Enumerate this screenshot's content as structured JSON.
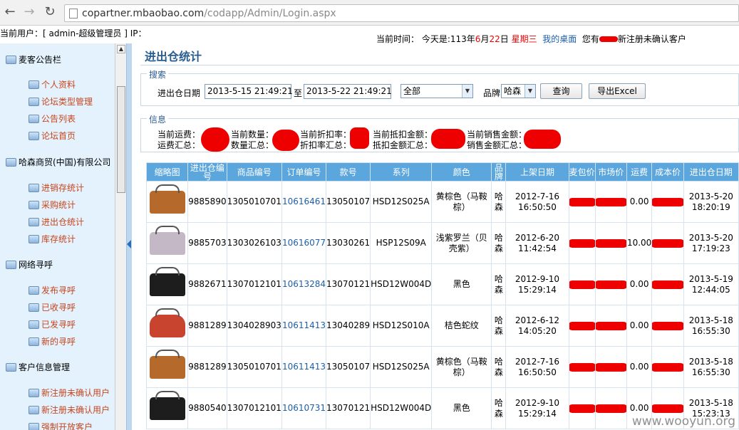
{
  "browser": {
    "url_host": "copartner.mbaobao.com",
    "url_path": "/codapp/Admin/Login.aspx"
  },
  "topbar": {
    "user_label": "当前用户：[ admin-超级管理员 ] IP：",
    "time_label": "当前时间：",
    "today_label": "今天是:113年",
    "month": "6",
    "month_suffix": "月",
    "day": "22",
    "day_suffix": "日",
    "weekday": "星期三",
    "desktop_link": "我的桌面",
    "pending_prefix": "您有",
    "pending_suffix": "新注册未确认客户"
  },
  "sidebar": {
    "sections": [
      {
        "title": "麦客公告栏",
        "items": [
          "个人资料",
          "论坛类型管理",
          "公告列表",
          "论坛首页"
        ]
      },
      {
        "title": "哈森商贸(中国)有限公司",
        "items": [
          "进销存统计",
          "采购统计",
          "进出仓统计",
          "库存统计"
        ]
      },
      {
        "title": "网络寻呼",
        "items": [
          "发布寻呼",
          "已收寻呼",
          "已发寻呼",
          "新的寻呼"
        ]
      },
      {
        "title": "客户信息管理",
        "items": [
          "新注册未确认用户",
          "新注册未确认用户",
          "强制开放客户"
        ]
      }
    ]
  },
  "page_title": "进出仓统计",
  "search": {
    "legend": "搜索",
    "date_label": "进出仓日期",
    "date_from": "2013-5-15 21:49:21",
    "to_label": "至",
    "date_to": "2013-5-22 21:49:21",
    "type_value": "全部",
    "brand_label": "品牌",
    "brand_value": "哈森",
    "query_button": "查询",
    "export_button": "导出Excel"
  },
  "info": {
    "legend": "信息",
    "row1": [
      "当前运费：",
      "当前数量：",
      "当前折扣率：",
      "当前抵扣金额：",
      "当前销售金额："
    ],
    "row2": [
      "运费汇总：",
      "数量汇总：",
      "折扣率汇总：",
      "抵扣金额汇总：",
      "销售金额汇总："
    ]
  },
  "table": {
    "headers": [
      "缩略图",
      "进出仓编号",
      "商品编号",
      "订单编号",
      "款号",
      "系列",
      "颜色",
      "品牌",
      "上架日期",
      "麦包价",
      "市场价",
      "运费",
      "成本价",
      "进出仓日期"
    ],
    "rows": [
      {
        "bag": "tan",
        "inout_no": "9885890",
        "product_no": "1305010701",
        "order_no": "10616461",
        "style_no": "13050107",
        "series": "HSD12S025A",
        "color": "黄棕色（马鞍棕）",
        "brand": "哈森",
        "listed": "2012-7-16 16:50:50",
        "shipping": "0.00",
        "inout_date": "2013-5-20 18:20:19"
      },
      {
        "bag": "lav",
        "inout_no": "9885703",
        "product_no": "1303026103",
        "order_no": "10616077",
        "style_no": "13030261",
        "series": "HSP12S09A",
        "color": "浅紫罗兰（贝壳紫）",
        "brand": "哈森",
        "listed": "2012-6-20 11:42:54",
        "shipping": "10.00",
        "inout_date": "2013-5-20 17:19:23"
      },
      {
        "bag": "blk",
        "inout_no": "9882671",
        "product_no": "1307012101",
        "order_no": "10613284",
        "style_no": "13070121",
        "series": "HSD12W004D",
        "color": "黑色",
        "brand": "哈森",
        "listed": "2012-9-10 15:29:14",
        "shipping": "0.00",
        "inout_date": "2013-5-19 12:44:05"
      },
      {
        "bag": "red",
        "inout_no": "9881289",
        "product_no": "1304028903",
        "order_no": "10611413",
        "style_no": "13040289",
        "series": "HSD12S010A",
        "color": "桔色蛇纹",
        "brand": "哈森",
        "listed": "2012-6-12 14:05:20",
        "shipping": "0.00",
        "inout_date": "2013-5-18 16:55:30"
      },
      {
        "bag": "tan",
        "inout_no": "9881289",
        "product_no": "1305010701",
        "order_no": "10611413",
        "style_no": "13050107",
        "series": "HSD12S025A",
        "color": "黄棕色（马鞍棕）",
        "brand": "哈森",
        "listed": "2012-7-16 16:50:50",
        "shipping": "0.00",
        "inout_date": "2013-5-18 16:55:30"
      },
      {
        "bag": "blk",
        "inout_no": "9880540",
        "product_no": "1307012101",
        "order_no": "10610731",
        "style_no": "13070121",
        "series": "HSD12W004D",
        "color": "黑色",
        "brand": "哈森",
        "listed": "2012-9-10 15:29:14",
        "shipping": "0.00",
        "inout_date": "2013-5-18 15:23:13"
      }
    ]
  },
  "watermark": "www.wooyun.org",
  "colors": {
    "header_blue": "#5ba6dc",
    "sidebar_bg": "#e3f2fc",
    "link_orange": "#c8451e",
    "redaction": "#e00000"
  }
}
